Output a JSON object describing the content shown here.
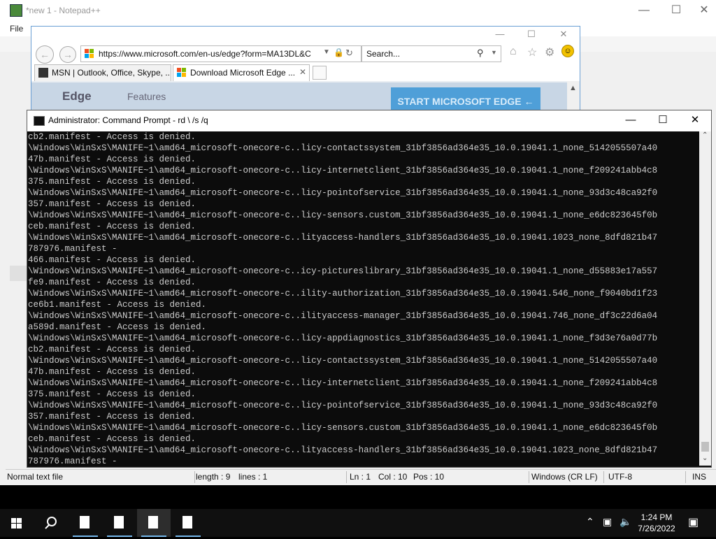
{
  "notepad": {
    "title": "*new 1 - Notepad++",
    "menu_file": "File",
    "status": {
      "type": "Normal text file",
      "length": "length : 9",
      "lines": "lines : 1",
      "ln": "Ln : 1",
      "col": "Col : 10",
      "pos": "Pos : 10",
      "eol": "Windows (CR LF)",
      "encoding": "UTF-8",
      "mode": "INS"
    }
  },
  "browser": {
    "url": "https://www.microsoft.com/en-us/edge?form=MA13DL&C",
    "search_placeholder": "Search...",
    "tabs": [
      {
        "label": "MSN | Outlook, Office, Skype, ..."
      },
      {
        "label": "Download Microsoft Edge ..."
      }
    ],
    "page": {
      "brand": "Edge",
      "nav_features": "Features",
      "start_button": "START MICROSOFT EDGE"
    }
  },
  "cmd": {
    "title": "Administrator: Command Prompt - rd  \\ /s /q",
    "lines": [
      "cb2.manifest - Access is denied.",
      "\\Windows\\WinSxS\\MANIFE~1\\amd64_microsoft-onecore-c..licy-contactssystem_31bf3856ad364e35_10.0.19041.1_none_5142055507a40",
      "47b.manifest - Access is denied.",
      "\\Windows\\WinSxS\\MANIFE~1\\amd64_microsoft-onecore-c..licy-internetclient_31bf3856ad364e35_10.0.19041.1_none_f209241abb4c8",
      "375.manifest - Access is denied.",
      "\\Windows\\WinSxS\\MANIFE~1\\amd64_microsoft-onecore-c..licy-pointofservice_31bf3856ad364e35_10.0.19041.1_none_93d3c48ca92f0",
      "357.manifest - Access is denied.",
      "\\Windows\\WinSxS\\MANIFE~1\\amd64_microsoft-onecore-c..licy-sensors.custom_31bf3856ad364e35_10.0.19041.1_none_e6dc823645f0b",
      "ceb.manifest - Access is denied.",
      "\\Windows\\WinSxS\\MANIFE~1\\amd64_microsoft-onecore-c..lityaccess-handlers_31bf3856ad364e35_10.0.19041.1023_none_8dfd821b47",
      "787976.manifest -",
      "466.manifest - Access is denied.",
      "\\Windows\\WinSxS\\MANIFE~1\\amd64_microsoft-onecore-c..icy-pictureslibrary_31bf3856ad364e35_10.0.19041.1_none_d55883e17a557",
      "fe9.manifest - Access is denied.",
      "\\Windows\\WinSxS\\MANIFE~1\\amd64_microsoft-onecore-c..ility-authorization_31bf3856ad364e35_10.0.19041.546_none_f9040bd1f23",
      "ce6b1.manifest - Access is denied.",
      "\\Windows\\WinSxS\\MANIFE~1\\amd64_microsoft-onecore-c..ilityaccess-manager_31bf3856ad364e35_10.0.19041.746_none_df3c22d6a04",
      "a589d.manifest - Access is denied.",
      "\\Windows\\WinSxS\\MANIFE~1\\amd64_microsoft-onecore-c..licy-appdiagnostics_31bf3856ad364e35_10.0.19041.1_none_f3d3e76a0d77b",
      "cb2.manifest - Access is denied.",
      "\\Windows\\WinSxS\\MANIFE~1\\amd64_microsoft-onecore-c..licy-contactssystem_31bf3856ad364e35_10.0.19041.1_none_5142055507a40",
      "47b.manifest - Access is denied.",
      "\\Windows\\WinSxS\\MANIFE~1\\amd64_microsoft-onecore-c..licy-internetclient_31bf3856ad364e35_10.0.19041.1_none_f209241abb4c8",
      "375.manifest - Access is denied.",
      "\\Windows\\WinSxS\\MANIFE~1\\amd64_microsoft-onecore-c..licy-pointofservice_31bf3856ad364e35_10.0.19041.1_none_93d3c48ca92f0",
      "357.manifest - Access is denied.",
      "\\Windows\\WinSxS\\MANIFE~1\\amd64_microsoft-onecore-c..licy-sensors.custom_31bf3856ad364e35_10.0.19041.1_none_e6dc823645f0b",
      "ceb.manifest - Access is denied.",
      "\\Windows\\WinSxS\\MANIFE~1\\amd64_microsoft-onecore-c..lityaccess-handlers_31bf3856ad364e35_10.0.19041.1023_none_8dfd821b47",
      "787976.manifest -"
    ]
  },
  "taskbar": {
    "time": "1:24 PM",
    "date": "7/26/2022"
  }
}
